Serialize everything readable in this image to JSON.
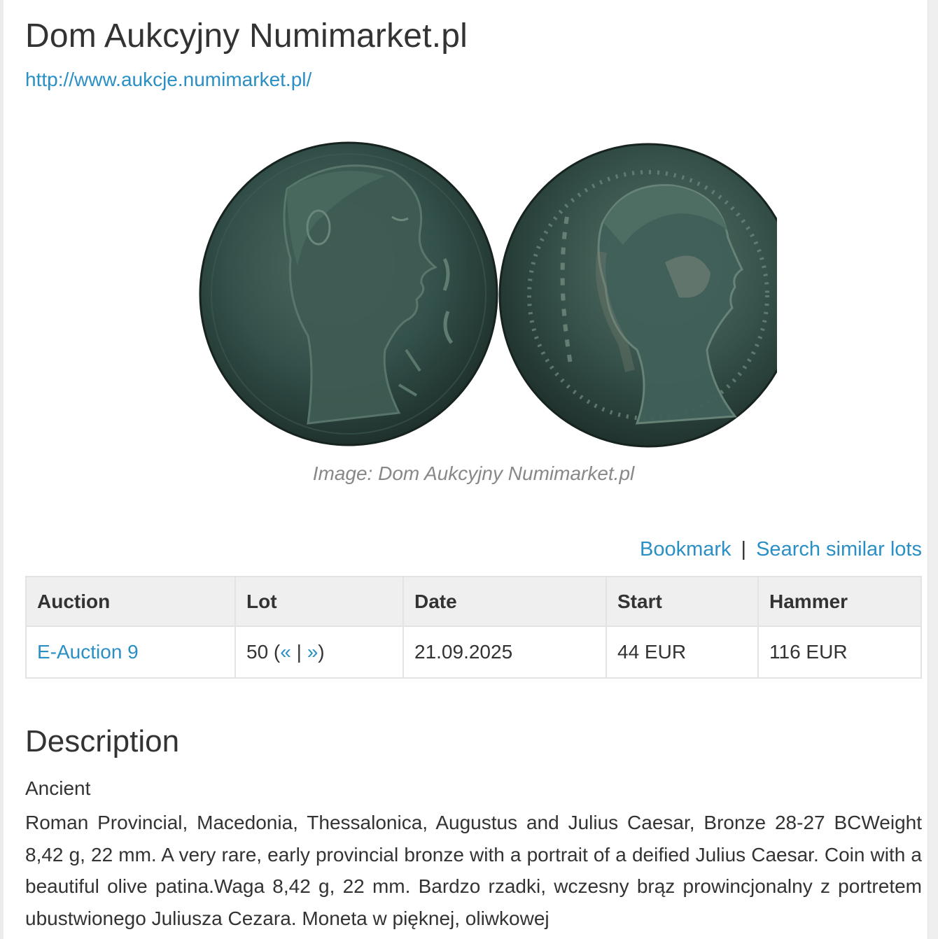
{
  "header": {
    "title": "Dom Aukcyjny Numimarket.pl",
    "url": "http://www.aukcje.numimarket.pl/"
  },
  "image": {
    "caption": "Image: Dom Aukcyjny Numimarket.pl",
    "coin_colors": {
      "patina_dark": "#1f302b",
      "patina_mid": "#35524a",
      "patina_light": "#58756a"
    }
  },
  "actions": {
    "bookmark": "Bookmark",
    "separator": "|",
    "search_similar": "Search similar lots"
  },
  "lot_table": {
    "headers": {
      "auction": "Auction",
      "lot": "Lot",
      "date": "Date",
      "start": "Start",
      "hammer": "Hammer"
    },
    "row": {
      "auction": "E-Auction 9",
      "lot_number": "50",
      "lot_open": " (",
      "prev": "«",
      "lot_sep": " | ",
      "next": "»",
      "lot_close": ")",
      "date": "21.09.2025",
      "start": "44 EUR",
      "hammer": "116 EUR"
    }
  },
  "description": {
    "heading": "Description",
    "category": "Ancient",
    "text": "Roman Provincial, Macedonia, Thessalonica, Augustus and Julius Caesar, Bronze 28-27 BCWeight 8,42 g, 22 mm. A very rare, early provincial bronze with a portrait of a deified Julius Caesar. Coin with a beautiful olive patina.Waga 8,42 g, 22 mm. Bardzo rzadki, wczesny brąz prowincjonalny z portretem ubustwionego Juliusza Cezara. Moneta w pięknej, oliwkowej"
  },
  "colors": {
    "link": "#2a8fc4",
    "text": "#333333",
    "caption": "#888888",
    "table_header_bg": "#efefef",
    "table_border": "#e3e3e3"
  }
}
